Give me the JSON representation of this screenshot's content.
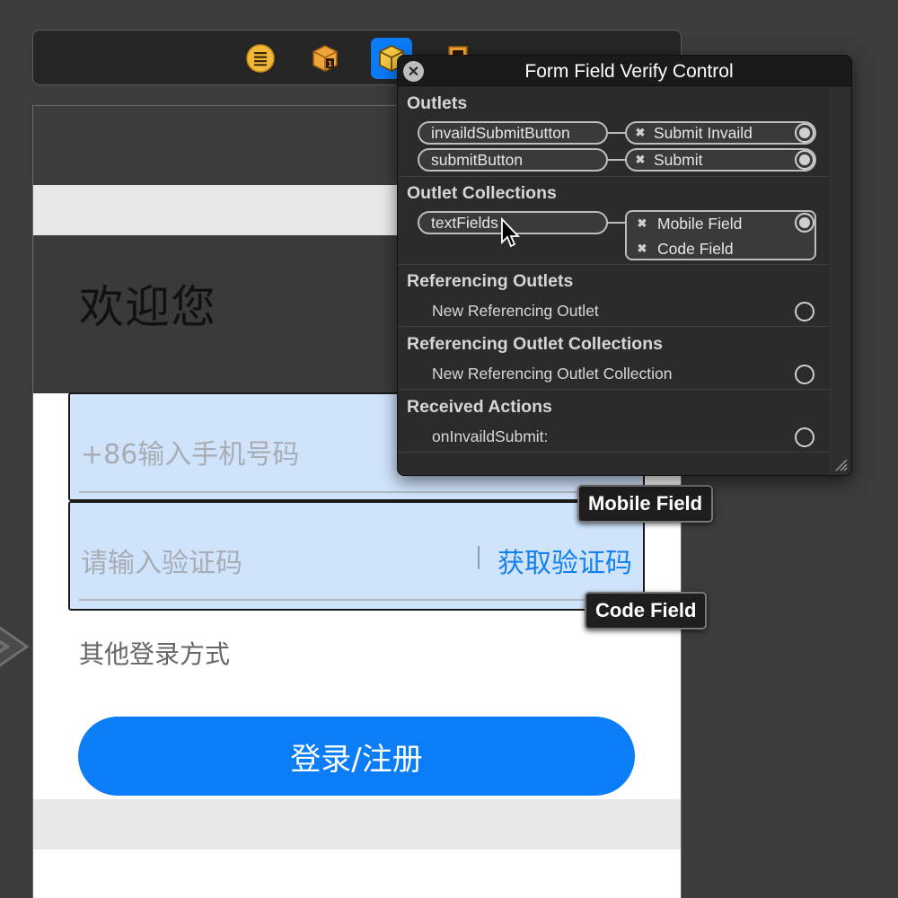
{
  "scene_dock": {
    "icons": [
      "view-controller-icon",
      "first-responder-icon",
      "form-field-verify-control-icon",
      "exit-icon"
    ]
  },
  "canvas": {
    "welcome_text": "欢迎您",
    "mobile_field": {
      "placeholder": "+86输入手机号码"
    },
    "code_field": {
      "placeholder": "请输入验证码",
      "separator": "|",
      "get_code_label": "获取验证码"
    },
    "other_login": "其他登录方式",
    "login_button": "登录/注册",
    "tags": {
      "mobile": "Mobile Field",
      "code": "Code Field"
    }
  },
  "popover": {
    "title": "Form Field Verify Control",
    "close_symbol": "✕",
    "sections": {
      "outlets": {
        "header": "Outlets",
        "rows": [
          {
            "outlet": "invaildSubmitButton",
            "target": "Submit Invaild"
          },
          {
            "outlet": "submitButton",
            "target": "Submit"
          }
        ]
      },
      "outlet_collections": {
        "header": "Outlet Collections",
        "outlet": "textFields",
        "targets": [
          "Mobile Field",
          "Code Field"
        ]
      },
      "referencing_outlets": {
        "header": "Referencing Outlets",
        "item": "New Referencing Outlet"
      },
      "referencing_outlet_collections": {
        "header": "Referencing Outlet Collections",
        "item": "New Referencing Outlet Collection"
      },
      "received_actions": {
        "header": "Received Actions",
        "item": "onInvaildSubmit:"
      }
    },
    "remove_symbol": "✖"
  },
  "colors": {
    "accent": "#0a7df7",
    "field_highlight": "#cfe3fb",
    "popover_bg": "#2b2b2b",
    "canvas_bg": "#3c3c3c"
  }
}
